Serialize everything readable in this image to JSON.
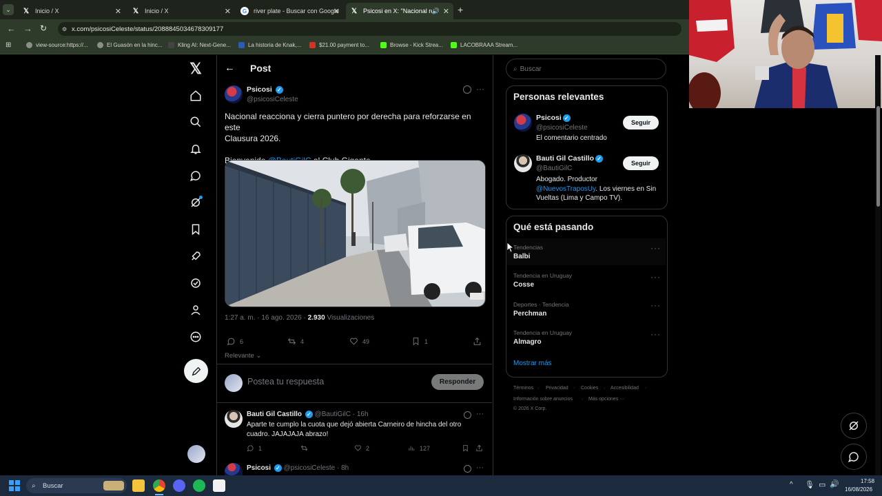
{
  "browser": {
    "tabs": [
      {
        "title": "Inicio / X",
        "icon": "x-logo-icon",
        "active": false
      },
      {
        "title": "Inicio / X",
        "icon": "x-logo-icon",
        "active": false
      },
      {
        "title": "river plate - Buscar con Google",
        "icon": "google-icon",
        "active": false
      },
      {
        "title": "Psicosi en X: \"Nacional reac",
        "icon": "x-logo-icon",
        "active": true
      }
    ],
    "url": "x.com/psicosiCeleste/status/2088845034678309177",
    "bookmarks": [
      "view-source:https://...",
      "El Guasón en la hinc...",
      "Kling AI: Next-Gene...",
      "La historia de Knak,...",
      "$21.00 payment to...",
      "Browse - Kick Strea...",
      "LACOBRAAA Stream..."
    ]
  },
  "header": {
    "title": "Post"
  },
  "post": {
    "author_name": "Psicosi",
    "author_handle": "@psicosiCeleste",
    "text_line1": "Nacional reacciona y cierra puntero por derecha para reforzarse en este",
    "text_line2": "Clausura 2026.",
    "welcome_prefix": "Bienvenido ",
    "welcome_mention": "@BautiGilC",
    "welcome_suffix": " al Club Gigante",
    "timestamp": "1:27 a. m. · 16 ago. 2026 · ",
    "views_count": "2.930",
    "views_label": " Visualizaciones",
    "stats": {
      "replies": "6",
      "reposts": "4",
      "likes": "49",
      "bookmarks": "1"
    },
    "sort_label": "Relevante"
  },
  "reply_box": {
    "placeholder": "Postea tu respuesta",
    "button": "Responder"
  },
  "replies": [
    {
      "name": "Bauti Gil Castillo",
      "handle": "@BautiGilC",
      "time": "· 16h",
      "text_line1": "Aparte te cumplo la cuota que dejó abierta Carneiro de hincha del otro",
      "text_line2": "cuadro. JAJAJAJA abrazo!",
      "replies": "1",
      "likes": "2",
      "views": "127"
    },
    {
      "name": "Psicosi",
      "handle": "@psicosiCeleste",
      "time": "· 8h"
    }
  ],
  "search": {
    "placeholder": "Buscar"
  },
  "relevant": {
    "title": "Personas relevantes",
    "people": [
      {
        "name": "Psicosi",
        "handle": "@psicosiCeleste",
        "bio": "El comentario centrado",
        "button": "Seguir"
      },
      {
        "name": "Bauti Gil Castillo",
        "handle": "@BautiGilC",
        "bio_line1": "Abogado. Productor",
        "bio_mention": "@NuevosTraposUy",
        "bio_rest1": ". Los viernes en Sin",
        "bio_line3": "Vueltas (Lima y Campo TV).",
        "button": "Seguir"
      }
    ]
  },
  "trends": {
    "title": "Qué está pasando",
    "items": [
      {
        "category": "Tendencias",
        "name": "Balbi"
      },
      {
        "category": "Tendencia en Uruguay",
        "name": "Cosse"
      },
      {
        "category": "Deportes · Tendencia",
        "name": "Perchman"
      },
      {
        "category": "Tendencia en Uruguay",
        "name": "Almagro"
      }
    ],
    "show_more": "Mostrar más"
  },
  "footer": {
    "links": [
      "Términos",
      "Privacidad",
      "Cookies",
      "Accesibilidad",
      "Información sobre anuncios",
      "Más opciones ···"
    ],
    "copyright": "© 2026 X Corp."
  },
  "taskbar": {
    "search": "Buscar",
    "time": "17:58",
    "date": "16/08/2026"
  },
  "colors": {
    "accent": "#1d9bf0",
    "background": "#000000",
    "border": "#2f3336",
    "muted": "#71767b"
  }
}
